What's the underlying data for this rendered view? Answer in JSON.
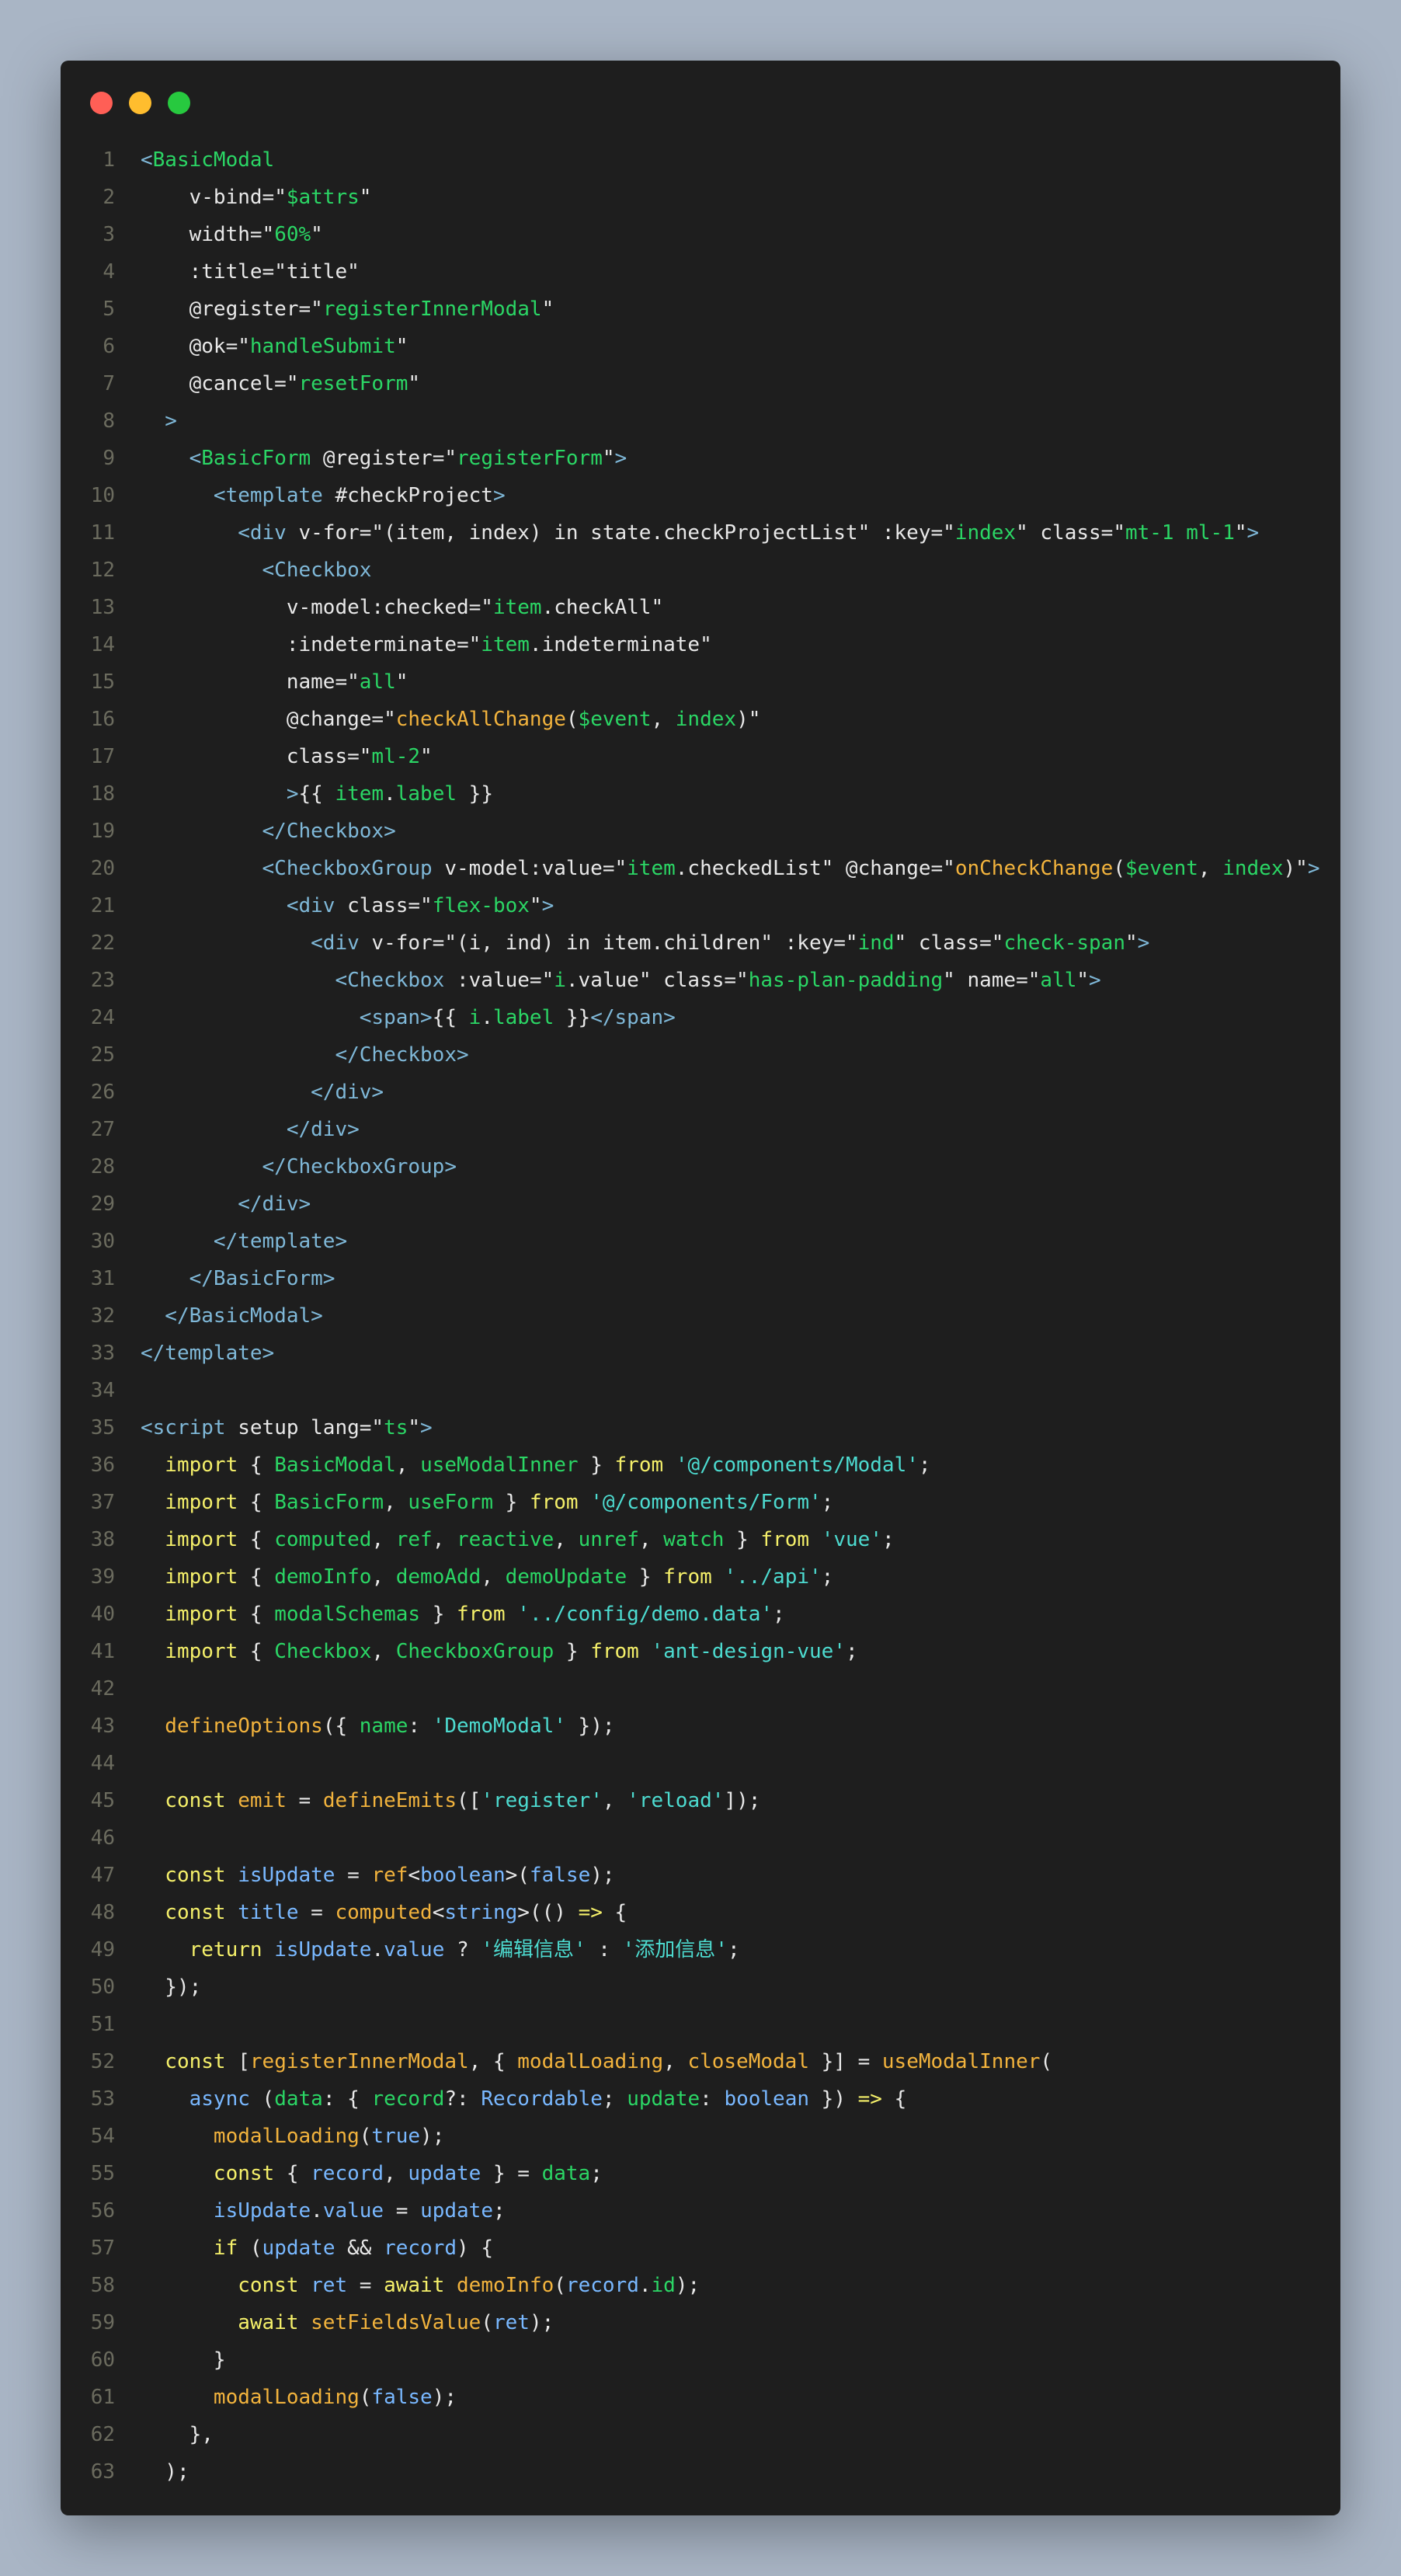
{
  "window": {
    "buttons": [
      "close",
      "minimize",
      "maximize"
    ]
  },
  "code_lines": [
    [
      [
        "t",
        "<"
      ],
      [
        "n",
        "BasicModal"
      ]
    ],
    [
      [
        "w",
        "    v-bind="
      ],
      [
        "q",
        "\""
      ],
      [
        "s",
        "$attrs"
      ],
      [
        "q",
        "\""
      ]
    ],
    [
      [
        "w",
        "    width="
      ],
      [
        "q",
        "\""
      ],
      [
        "s",
        "60%"
      ],
      [
        "q",
        "\""
      ]
    ],
    [
      [
        "w",
        "    :title="
      ],
      [
        "q",
        "\""
      ],
      [
        "w",
        "title"
      ],
      [
        "q",
        "\""
      ]
    ],
    [
      [
        "w",
        "    @register="
      ],
      [
        "q",
        "\""
      ],
      [
        "s",
        "registerInnerModal"
      ],
      [
        "q",
        "\""
      ]
    ],
    [
      [
        "w",
        "    @ok="
      ],
      [
        "q",
        "\""
      ],
      [
        "s",
        "handleSubmit"
      ],
      [
        "q",
        "\""
      ]
    ],
    [
      [
        "w",
        "    @cancel="
      ],
      [
        "q",
        "\""
      ],
      [
        "s",
        "resetForm"
      ],
      [
        "q",
        "\""
      ]
    ],
    [
      [
        "t",
        "  >"
      ]
    ],
    [
      [
        "t",
        "    <"
      ],
      [
        "n",
        "BasicForm"
      ],
      [
        "w",
        " @register="
      ],
      [
        "q",
        "\""
      ],
      [
        "s",
        "registerForm"
      ],
      [
        "q",
        "\""
      ],
      [
        "t",
        ">"
      ]
    ],
    [
      [
        "t",
        "      <template"
      ],
      [
        "w",
        " #checkProject"
      ],
      [
        "t",
        ">"
      ]
    ],
    [
      [
        "t",
        "        <div"
      ],
      [
        "w",
        " v-for="
      ],
      [
        "q",
        "\""
      ],
      [
        "w",
        "(item, index) in state.checkProjectList"
      ],
      [
        "q",
        "\""
      ],
      [
        "w",
        " :key="
      ],
      [
        "q",
        "\""
      ],
      [
        "s",
        "index"
      ],
      [
        "q",
        "\""
      ],
      [
        "w",
        " class="
      ],
      [
        "q",
        "\""
      ],
      [
        "s",
        "mt-1 ml-1"
      ],
      [
        "q",
        "\""
      ],
      [
        "t",
        ">"
      ]
    ],
    [
      [
        "t",
        "          <Checkbox"
      ]
    ],
    [
      [
        "w",
        "            v-model:checked="
      ],
      [
        "q",
        "\""
      ],
      [
        "s",
        "item"
      ],
      [
        "w",
        ".checkAll"
      ],
      [
        "q",
        "\""
      ]
    ],
    [
      [
        "w",
        "            :indeterminate="
      ],
      [
        "q",
        "\""
      ],
      [
        "s",
        "item"
      ],
      [
        "w",
        ".indeterminate"
      ],
      [
        "q",
        "\""
      ]
    ],
    [
      [
        "w",
        "            name="
      ],
      [
        "q",
        "\""
      ],
      [
        "s",
        "all"
      ],
      [
        "q",
        "\""
      ]
    ],
    [
      [
        "w",
        "            @change="
      ],
      [
        "q",
        "\""
      ],
      [
        "f",
        "checkAllChange"
      ],
      [
        "w",
        "("
      ],
      [
        "s",
        "$event"
      ],
      [
        "w",
        ", "
      ],
      [
        "s",
        "index"
      ],
      [
        "w",
        ")"
      ],
      [
        "q",
        "\""
      ]
    ],
    [
      [
        "w",
        "            class="
      ],
      [
        "q",
        "\""
      ],
      [
        "s",
        "ml-2"
      ],
      [
        "q",
        "\""
      ]
    ],
    [
      [
        "t",
        "            >"
      ],
      [
        "w",
        "{{ "
      ],
      [
        "s",
        "item"
      ],
      [
        "w",
        "."
      ],
      [
        "s",
        "label"
      ],
      [
        "w",
        " }}"
      ]
    ],
    [
      [
        "t",
        "          </Checkbox>"
      ]
    ],
    [
      [
        "t",
        "          <CheckboxGroup"
      ],
      [
        "w",
        " v-model:value="
      ],
      [
        "q",
        "\""
      ],
      [
        "s",
        "item"
      ],
      [
        "w",
        ".checkedList"
      ],
      [
        "q",
        "\""
      ],
      [
        "w",
        " @change="
      ],
      [
        "q",
        "\""
      ],
      [
        "f",
        "onCheckChange"
      ],
      [
        "w",
        "("
      ],
      [
        "s",
        "$event"
      ],
      [
        "w",
        ", "
      ],
      [
        "s",
        "index"
      ],
      [
        "w",
        ")"
      ],
      [
        "q",
        "\""
      ],
      [
        "t",
        ">"
      ]
    ],
    [
      [
        "t",
        "            <div"
      ],
      [
        "w",
        " class="
      ],
      [
        "q",
        "\""
      ],
      [
        "s",
        "flex-box"
      ],
      [
        "q",
        "\""
      ],
      [
        "t",
        ">"
      ]
    ],
    [
      [
        "t",
        "              <div"
      ],
      [
        "w",
        " v-for="
      ],
      [
        "q",
        "\""
      ],
      [
        "w",
        "(i, ind) in item.children"
      ],
      [
        "q",
        "\""
      ],
      [
        "w",
        " :key="
      ],
      [
        "q",
        "\""
      ],
      [
        "s",
        "ind"
      ],
      [
        "q",
        "\""
      ],
      [
        "w",
        " class="
      ],
      [
        "q",
        "\""
      ],
      [
        "s",
        "check-span"
      ],
      [
        "q",
        "\""
      ],
      [
        "t",
        ">"
      ]
    ],
    [
      [
        "t",
        "                <Checkbox"
      ],
      [
        "w",
        " :value="
      ],
      [
        "q",
        "\""
      ],
      [
        "s",
        "i"
      ],
      [
        "w",
        ".value"
      ],
      [
        "q",
        "\""
      ],
      [
        "w",
        " class="
      ],
      [
        "q",
        "\""
      ],
      [
        "s",
        "has-plan-padding"
      ],
      [
        "q",
        "\""
      ],
      [
        "w",
        " name="
      ],
      [
        "q",
        "\""
      ],
      [
        "s",
        "all"
      ],
      [
        "q",
        "\""
      ],
      [
        "t",
        ">"
      ]
    ],
    [
      [
        "t",
        "                  <span>"
      ],
      [
        "w",
        "{{ "
      ],
      [
        "s",
        "i"
      ],
      [
        "w",
        "."
      ],
      [
        "s",
        "label"
      ],
      [
        "w",
        " }}"
      ],
      [
        "t",
        "</span>"
      ]
    ],
    [
      [
        "t",
        "                </Checkbox>"
      ]
    ],
    [
      [
        "t",
        "              </div>"
      ]
    ],
    [
      [
        "t",
        "            </div>"
      ]
    ],
    [
      [
        "t",
        "          </CheckboxGroup>"
      ]
    ],
    [
      [
        "t",
        "        </div>"
      ]
    ],
    [
      [
        "t",
        "      </template>"
      ]
    ],
    [
      [
        "t",
        "    </BasicForm>"
      ]
    ],
    [
      [
        "t",
        "  </BasicModal>"
      ]
    ],
    [
      [
        "t",
        "</template>"
      ]
    ],
    [],
    [
      [
        "t",
        "<script"
      ],
      [
        "w",
        " setup lang="
      ],
      [
        "q",
        "\""
      ],
      [
        "s",
        "ts"
      ],
      [
        "q",
        "\""
      ],
      [
        "t",
        ">"
      ]
    ],
    [
      [
        "k",
        "  import"
      ],
      [
        "w",
        " { "
      ],
      [
        "n",
        "BasicModal"
      ],
      [
        "w",
        ", "
      ],
      [
        "n",
        "useModalInner"
      ],
      [
        "w",
        " } "
      ],
      [
        "k",
        "from"
      ],
      [
        "w",
        " "
      ],
      [
        "c",
        "'@/components/Modal'"
      ],
      [
        "w",
        ";"
      ]
    ],
    [
      [
        "k",
        "  import"
      ],
      [
        "w",
        " { "
      ],
      [
        "n",
        "BasicForm"
      ],
      [
        "w",
        ", "
      ],
      [
        "n",
        "useForm"
      ],
      [
        "w",
        " } "
      ],
      [
        "k",
        "from"
      ],
      [
        "w",
        " "
      ],
      [
        "c",
        "'@/components/Form'"
      ],
      [
        "w",
        ";"
      ]
    ],
    [
      [
        "k",
        "  import"
      ],
      [
        "w",
        " { "
      ],
      [
        "n",
        "computed"
      ],
      [
        "w",
        ", "
      ],
      [
        "n",
        "ref"
      ],
      [
        "w",
        ", "
      ],
      [
        "n",
        "reactive"
      ],
      [
        "w",
        ", "
      ],
      [
        "n",
        "unref"
      ],
      [
        "w",
        ", "
      ],
      [
        "n",
        "watch"
      ],
      [
        "w",
        " } "
      ],
      [
        "k",
        "from"
      ],
      [
        "w",
        " "
      ],
      [
        "c",
        "'vue'"
      ],
      [
        "w",
        ";"
      ]
    ],
    [
      [
        "k",
        "  import"
      ],
      [
        "w",
        " { "
      ],
      [
        "n",
        "demoInfo"
      ],
      [
        "w",
        ", "
      ],
      [
        "n",
        "demoAdd"
      ],
      [
        "w",
        ", "
      ],
      [
        "n",
        "demoUpdate"
      ],
      [
        "w",
        " } "
      ],
      [
        "k",
        "from"
      ],
      [
        "w",
        " "
      ],
      [
        "c",
        "'../api'"
      ],
      [
        "w",
        ";"
      ]
    ],
    [
      [
        "k",
        "  import"
      ],
      [
        "w",
        " { "
      ],
      [
        "n",
        "modalSchemas"
      ],
      [
        "w",
        " } "
      ],
      [
        "k",
        "from"
      ],
      [
        "w",
        " "
      ],
      [
        "c",
        "'../config/demo.data'"
      ],
      [
        "w",
        ";"
      ]
    ],
    [
      [
        "k",
        "  import"
      ],
      [
        "w",
        " { "
      ],
      [
        "n",
        "Checkbox"
      ],
      [
        "w",
        ", "
      ],
      [
        "n",
        "CheckboxGroup"
      ],
      [
        "w",
        " } "
      ],
      [
        "k",
        "from"
      ],
      [
        "w",
        " "
      ],
      [
        "c",
        "'ant-design-vue'"
      ],
      [
        "w",
        ";"
      ]
    ],
    [],
    [
      [
        "f",
        "  defineOptions"
      ],
      [
        "w",
        "({ "
      ],
      [
        "n",
        "name"
      ],
      [
        "w",
        ": "
      ],
      [
        "c",
        "'DemoModal'"
      ],
      [
        "w",
        " });"
      ]
    ],
    [],
    [
      [
        "k",
        "  const"
      ],
      [
        "w",
        " "
      ],
      [
        "f",
        "emit"
      ],
      [
        "w",
        " = "
      ],
      [
        "f",
        "defineEmits"
      ],
      [
        "w",
        "(["
      ],
      [
        "c",
        "'register'"
      ],
      [
        "w",
        ", "
      ],
      [
        "c",
        "'reload'"
      ],
      [
        "w",
        "]);"
      ]
    ],
    [],
    [
      [
        "k",
        "  const"
      ],
      [
        "w",
        " "
      ],
      [
        "v",
        "isUpdate"
      ],
      [
        "w",
        " = "
      ],
      [
        "f",
        "ref"
      ],
      [
        "w",
        "<"
      ],
      [
        "v",
        "boolean"
      ],
      [
        "w",
        ">("
      ],
      [
        "v",
        "false"
      ],
      [
        "w",
        ");"
      ]
    ],
    [
      [
        "k",
        "  const"
      ],
      [
        "w",
        " "
      ],
      [
        "v",
        "title"
      ],
      [
        "w",
        " = "
      ],
      [
        "f",
        "computed"
      ],
      [
        "w",
        "<"
      ],
      [
        "v",
        "string"
      ],
      [
        "w",
        ">(() "
      ],
      [
        "k",
        "=>"
      ],
      [
        "w",
        " {"
      ]
    ],
    [
      [
        "k",
        "    return"
      ],
      [
        "w",
        " "
      ],
      [
        "v",
        "isUpdate"
      ],
      [
        "w",
        "."
      ],
      [
        "v",
        "value"
      ],
      [
        "w",
        " ? "
      ],
      [
        "c",
        "'编辑信息'"
      ],
      [
        "w",
        " : "
      ],
      [
        "c",
        "'添加信息'"
      ],
      [
        "w",
        ";"
      ]
    ],
    [
      [
        "w",
        "  });"
      ]
    ],
    [],
    [
      [
        "k",
        "  const"
      ],
      [
        "w",
        " ["
      ],
      [
        "f",
        "registerInnerModal"
      ],
      [
        "w",
        ", { "
      ],
      [
        "f",
        "modalLoading"
      ],
      [
        "w",
        ", "
      ],
      [
        "f",
        "closeModal"
      ],
      [
        "w",
        " }] = "
      ],
      [
        "f",
        "useModalInner"
      ],
      [
        "w",
        "("
      ]
    ],
    [
      [
        "v",
        "    async"
      ],
      [
        "w",
        " ("
      ],
      [
        "n",
        "data"
      ],
      [
        "w",
        ": { "
      ],
      [
        "n",
        "record"
      ],
      [
        "w",
        "?: "
      ],
      [
        "v",
        "Recordable"
      ],
      [
        "w",
        "; "
      ],
      [
        "n",
        "update"
      ],
      [
        "w",
        ": "
      ],
      [
        "v",
        "boolean"
      ],
      [
        "w",
        " }) "
      ],
      [
        "k",
        "=>"
      ],
      [
        "w",
        " {"
      ]
    ],
    [
      [
        "f",
        "      modalLoading"
      ],
      [
        "w",
        "("
      ],
      [
        "v",
        "true"
      ],
      [
        "w",
        ");"
      ]
    ],
    [
      [
        "k",
        "      const"
      ],
      [
        "w",
        " { "
      ],
      [
        "v",
        "record"
      ],
      [
        "w",
        ", "
      ],
      [
        "v",
        "update"
      ],
      [
        "w",
        " } = "
      ],
      [
        "n",
        "data"
      ],
      [
        "w",
        ";"
      ]
    ],
    [
      [
        "v",
        "      isUpdate"
      ],
      [
        "w",
        "."
      ],
      [
        "v",
        "value"
      ],
      [
        "w",
        " = "
      ],
      [
        "v",
        "update"
      ],
      [
        "w",
        ";"
      ]
    ],
    [
      [
        "k",
        "      if"
      ],
      [
        "w",
        " ("
      ],
      [
        "v",
        "update"
      ],
      [
        "w",
        " && "
      ],
      [
        "v",
        "record"
      ],
      [
        "w",
        ") {"
      ]
    ],
    [
      [
        "k",
        "        const"
      ],
      [
        "w",
        " "
      ],
      [
        "v",
        "ret"
      ],
      [
        "w",
        " = "
      ],
      [
        "k",
        "await"
      ],
      [
        "w",
        " "
      ],
      [
        "f",
        "demoInfo"
      ],
      [
        "w",
        "("
      ],
      [
        "v",
        "record"
      ],
      [
        "w",
        "."
      ],
      [
        "n",
        "id"
      ],
      [
        "w",
        ");"
      ]
    ],
    [
      [
        "k",
        "        await"
      ],
      [
        "w",
        " "
      ],
      [
        "f",
        "setFieldsValue"
      ],
      [
        "w",
        "("
      ],
      [
        "v",
        "ret"
      ],
      [
        "w",
        ");"
      ]
    ],
    [
      [
        "w",
        "      }"
      ]
    ],
    [
      [
        "f",
        "      modalLoading"
      ],
      [
        "w",
        "("
      ],
      [
        "v",
        "false"
      ],
      [
        "w",
        ");"
      ]
    ],
    [
      [
        "w",
        "    },"
      ]
    ],
    [
      [
        "w",
        "  );"
      ]
    ]
  ]
}
